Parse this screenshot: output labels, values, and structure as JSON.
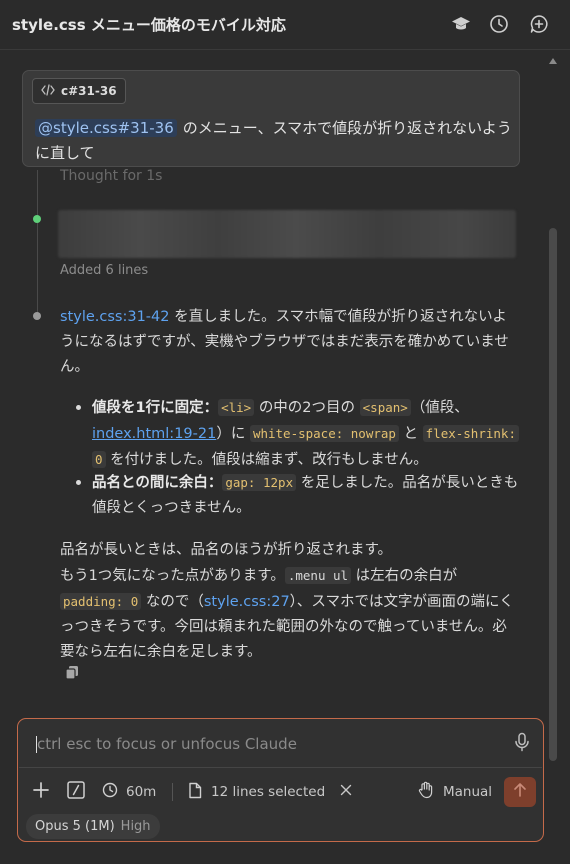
{
  "header": {
    "title": "style.css メニュー価格のモバイル対応"
  },
  "user_message": {
    "chip_label": "c#31-36",
    "mention": "@style.css#31-36",
    "text": "のメニュー、スマホで値段が折り返されないように直して"
  },
  "steps": {
    "thought": "Thought for 1s",
    "added": "Added 6 lines"
  },
  "response": {
    "intro_link": "style.css:31-42",
    "intro_text": "を直しました。スマホ幅で値段が折り返されないようになるはずですが、実機やブラウザではまだ表示を確かめていません。",
    "bullet1": {
      "title": "値段を1行に固定：",
      "code1": "<li>",
      "t1": "の中の2つ目の",
      "code2": "<span>",
      "t2": "（値段、",
      "link": "index.html:19-21",
      "t3": "）に",
      "code3": "white-space: nowrap",
      "t4": "と",
      "code4a": "flex-shrink:",
      "code4b": "0",
      "t5": "を付けました。値段は縮まず、改行もしません。"
    },
    "bullet2": {
      "title": "品名との間に余白：",
      "code": "gap: 12px",
      "text": "を足しました。品名が長いときも値段とくっつきません。"
    },
    "para2": "品名が長いときは、品名のほうが折り返されます。",
    "para3": {
      "t1": "もう1つ気になった点があります。",
      "code1": ".menu ul",
      "t2": "は左右の余白が",
      "code2": "padding: 0",
      "t3": "なので（",
      "link": "style.css:27",
      "t4": "）、スマホでは文字が画面の端にくっつきそうです。今回は頼まれた範囲の外なので触っていません。必要なら左右に余白を足します。"
    }
  },
  "composer": {
    "placeholder": "ctrl esc to focus or unfocus Claude",
    "time_limit": "60m",
    "selection": "12 lines selected",
    "mode": "Manual"
  },
  "model": {
    "name": "Opus 5 (1M)",
    "effort": "High"
  },
  "colors": {
    "accent": "#c46a4a",
    "link": "#5ea2ef",
    "code": "#e3c070",
    "dot_active": "#5fd07a"
  }
}
